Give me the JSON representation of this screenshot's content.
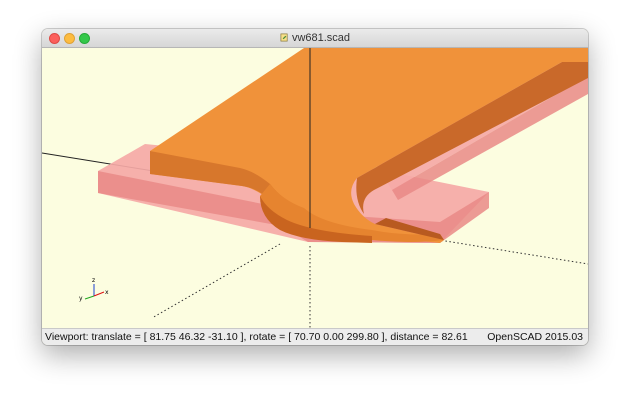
{
  "window": {
    "title": "vw681.scad",
    "title_icon": "scad-document-icon",
    "controls": [
      "close",
      "minimize",
      "zoom"
    ]
  },
  "viewport": {
    "background_color": "#fcfde0",
    "axis_indicator": {
      "x": "x",
      "y": "y",
      "z": "z"
    },
    "colors": {
      "main_part": "#f0923a",
      "main_part_side": "#d4732a",
      "highlight_part": "#f5a3a3",
      "highlight_side": "#e87e7e"
    }
  },
  "status": {
    "viewport_text": "Viewport: translate = [ 81.75 46.32 -31.10 ], rotate = [ 70.70 0.00 299.80 ], distance = 82.61",
    "app_version": "OpenSCAD 2015.03"
  }
}
